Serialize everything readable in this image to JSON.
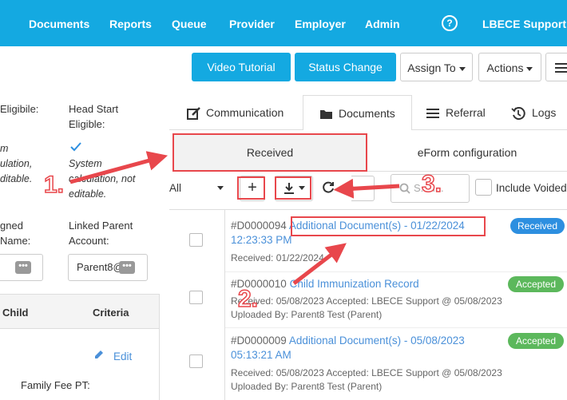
{
  "nav": {
    "items": [
      "Documents",
      "Reports",
      "Queue",
      "Provider",
      "Employer",
      "Admin"
    ],
    "help_glyph": "?",
    "user": "LBECE Support"
  },
  "actions": {
    "video_tutorial": "Video Tutorial",
    "status_change": "Status Change",
    "assign_to": "Assign To",
    "actions": "Actions"
  },
  "left_panel": {
    "eligible_label": "Eligibile:",
    "head_start_label": "Head Start",
    "head_start_label2": "Eligible:",
    "left_italic": [
      "m",
      "ulation,",
      "ditable."
    ],
    "system_calc": [
      "System",
      "calculation, not",
      "editable."
    ],
    "assigned_label": [
      "gned",
      "Name:"
    ],
    "linked_parent_label": [
      "Linked Parent",
      "Account:"
    ],
    "linked_parent_value": "Parent8@",
    "table_headers": [
      "Child",
      "Criteria"
    ],
    "edit": "Edit",
    "family_fee": "Family Fee PT:"
  },
  "tabs": [
    "Communication",
    "Documents",
    "Referral",
    "Logs"
  ],
  "subtabs": [
    "Received",
    "eForm configuration"
  ],
  "toolbar": {
    "filter": "All",
    "search_placeholder": "Search...",
    "search_visible": "S...h...",
    "include_voided": "Include Voided"
  },
  "documents": [
    {
      "id": "#D0000094",
      "title": "Additional Document(s) - 01/22/2024",
      "time": "12:23:33 PM",
      "meta": [
        "Received: 01/22/2024"
      ],
      "status": "Received"
    },
    {
      "id": "#D0000010",
      "title": "Child Immunization Record",
      "time": "",
      "meta": [
        "Received: 05/08/2023 Accepted: LBECE Support @ 05/08/2023",
        "Uploaded By: Parent8 Test (Parent)"
      ],
      "status": "Accepted"
    },
    {
      "id": "#D0000009",
      "title": "Additional Document(s) - 05/08/2023",
      "time": "05:13:21 AM",
      "meta": [
        "Received: 05/08/2023 Accepted: LBECE Support @ 05/08/2023",
        "Uploaded By: Parent8 Test (Parent)"
      ],
      "status": "Accepted"
    }
  ],
  "callouts": [
    "1.",
    "2.",
    "3."
  ],
  "colors": {
    "header": "#14a9e1",
    "highlight": "#e8474c",
    "received": "#2d8fe0",
    "accepted": "#5cb85c",
    "link": "#4a90d9"
  },
  "icons": [
    "help-icon",
    "edit-icon",
    "documents-folder-icon",
    "menu-lines-icon",
    "history-icon",
    "plus-icon",
    "download-icon",
    "refresh-icon",
    "search-icon",
    "check-icon",
    "pencil-icon",
    "dots-icon"
  ]
}
